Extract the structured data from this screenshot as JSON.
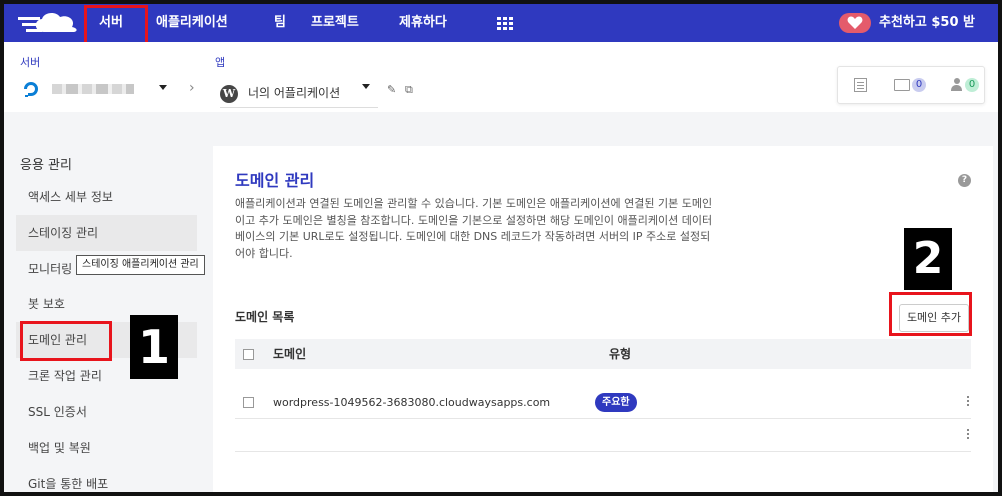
{
  "topnav": {
    "items": {
      "server": "서버",
      "apps": "애플리케이션",
      "team": "팀",
      "projects": "프로젝트",
      "partner": "제휴하다"
    },
    "refer": "추천하고 $50 받"
  },
  "breadcrumb": {
    "server_label": "서버",
    "app_label": "앱",
    "app_name": "너의 어플리케이션"
  },
  "toolbar": {
    "folder_count": "0",
    "user_count": "0"
  },
  "sidebar": {
    "heading": "응용 관리",
    "items": [
      "액세스 세부 정보",
      "스테이징 관리",
      "모니터링",
      "봇 보호",
      "도메인 관리",
      "크론 작업 관리",
      "SSL 인증서",
      "백업 및 복원",
      "Git을 통한 배포"
    ],
    "tooltip": "스테이징 애플리케이션 관리"
  },
  "annotations": {
    "one": "1",
    "two": "2"
  },
  "main": {
    "title": "도메인 관리",
    "description": "애플리케이션과 연결된 도메인을 관리할 수 있습니다. 기본 도메인은 애플리케이션에 연결된 기본 도메인이고 추가 도메인은 별칭을 참조합니다. 도메인을 기본으로 설정하면 해당 도메인이 애플리케이션 데이터베이스의 기본 URL로도 설정됩니다. 도메인에 대한 DNS 레코드가 작동하려면 서버의 IP 주소로 설정되어야 합니다.",
    "list_title": "도메인 목록",
    "add_button": "도메인 추가",
    "columns": {
      "domain": "도메인",
      "type": "유형"
    },
    "rows": [
      {
        "domain": "wordpress-1049562-3683080.cloudwaysapps.com",
        "type": "주요한"
      }
    ]
  },
  "colors": {
    "brand": "#2f39bf",
    "highlight": "#e8141c"
  }
}
